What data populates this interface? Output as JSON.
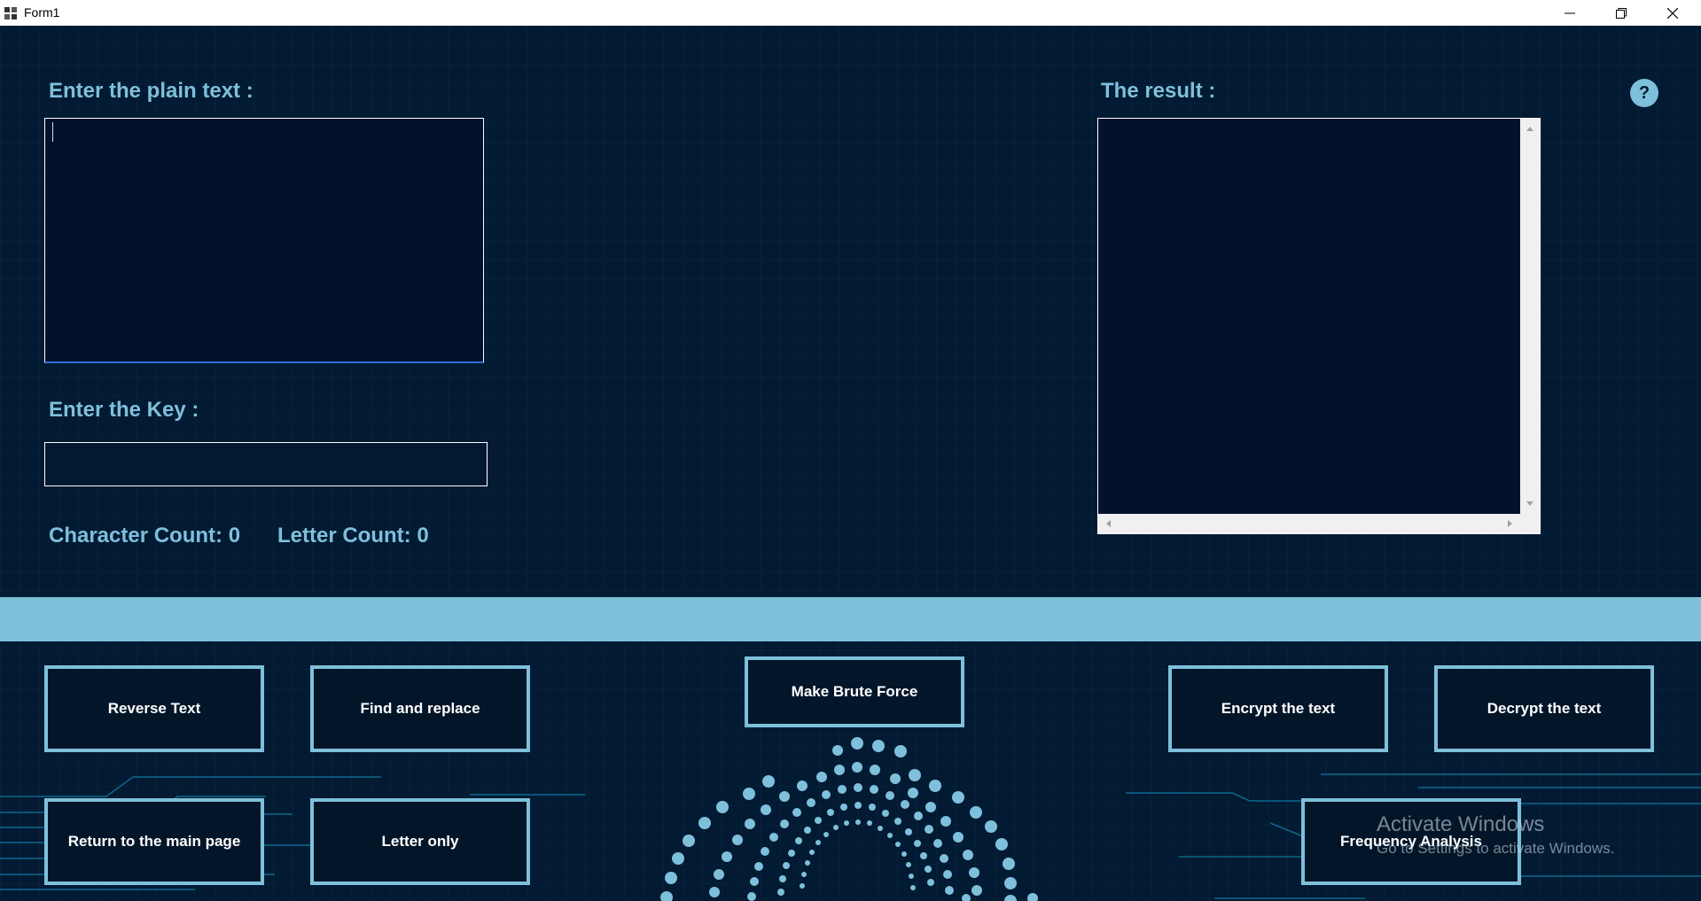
{
  "window": {
    "title": "Form1"
  },
  "labels": {
    "plain_text": "Enter the plain text :",
    "key": "Enter the Key :",
    "result": "The result :",
    "character_count": "Character Count: 0",
    "letter_count": "Letter Count: 0",
    "help": "?"
  },
  "inputs": {
    "plain_text_value": "",
    "key_value": "",
    "result_value": ""
  },
  "buttons": {
    "reverse_text": "Reverse Text",
    "find_replace": "Find and replace",
    "brute_force": "Make Brute Force",
    "encrypt": "Encrypt the text",
    "decrypt": "Decrypt the text",
    "return_main": "Return to the main page",
    "letter_only": "Letter only",
    "frequency_analysis": "Frequency Analysis"
  },
  "watermark": {
    "line1": "Activate Windows",
    "line2": "Go to Settings to activate Windows."
  },
  "colors": {
    "background": "#031a33",
    "accent": "#7ec0db",
    "button_text": "#ffffff"
  }
}
